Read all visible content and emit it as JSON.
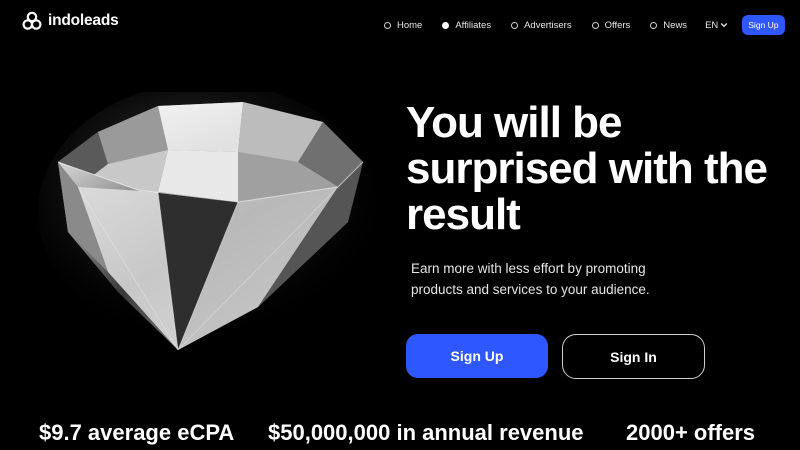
{
  "header": {
    "brand": "indoleads",
    "nav": [
      {
        "label": "Home",
        "active": false
      },
      {
        "label": "Affiliates",
        "active": true
      },
      {
        "label": "Advertisers",
        "active": false
      },
      {
        "label": "Offers",
        "active": false
      },
      {
        "label": "News",
        "active": false
      }
    ],
    "language": "EN",
    "signup_label": "Sign Up"
  },
  "hero": {
    "headline_line1": "You will be",
    "headline_line2": "surprised with the",
    "headline_line3": "result",
    "subtext_line1": "Earn more with less effort by promoting",
    "subtext_line2": "products and services to your audience.",
    "primary_cta": "Sign Up",
    "secondary_cta": "Sign In"
  },
  "stats": [
    "$9.7 average eCPA",
    "$50,000,000 in annual revenue",
    "2000+ offers"
  ],
  "colors": {
    "accent": "#2f57ff",
    "background": "#000000",
    "text": "#ffffff"
  },
  "icons": {
    "logo": "indoleads-logo-icon",
    "language_caret": "chevron-down-icon"
  }
}
